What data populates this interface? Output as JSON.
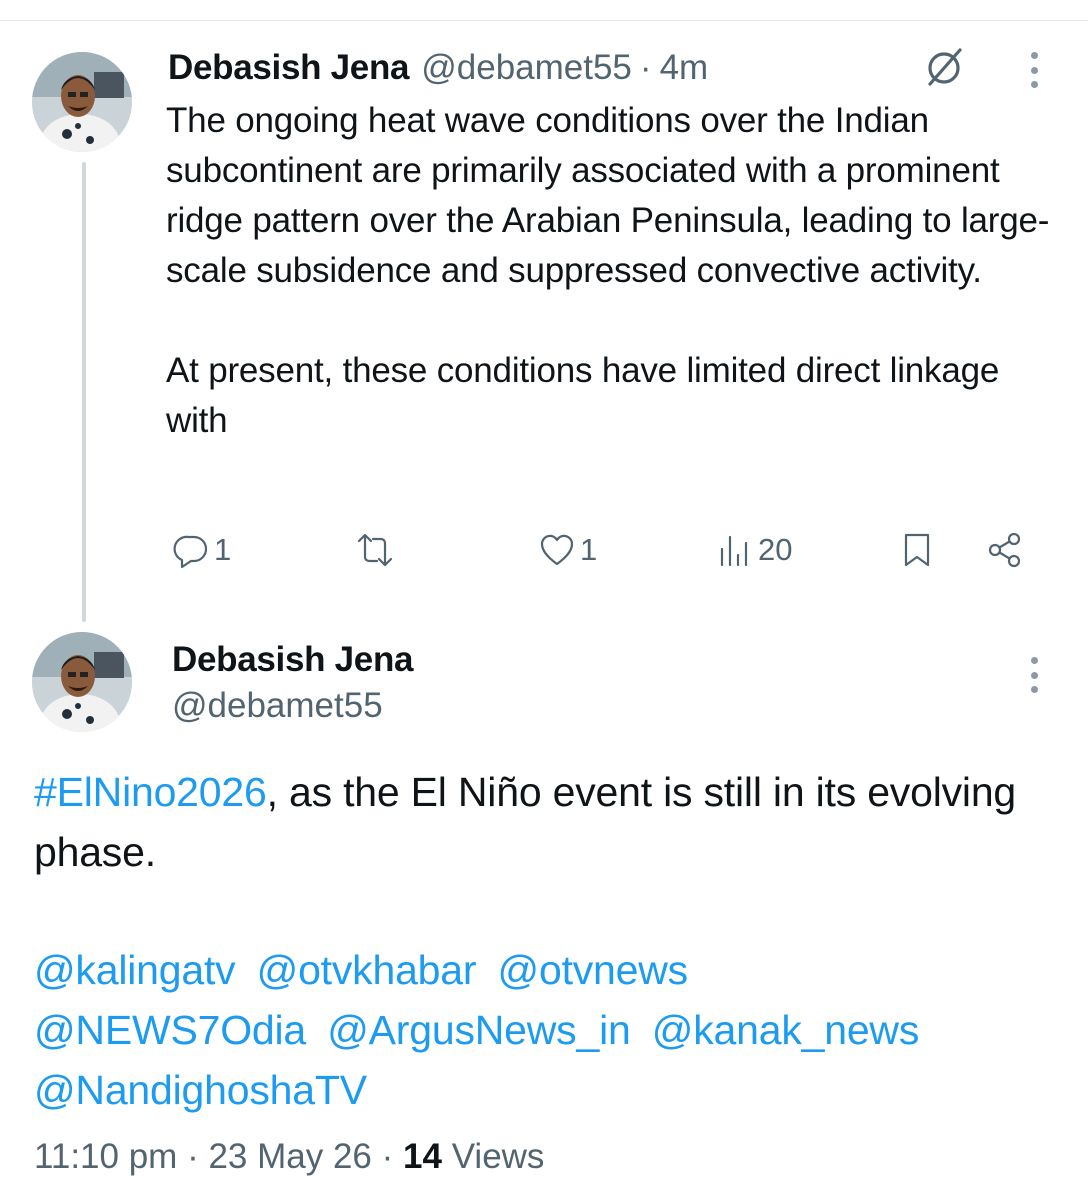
{
  "colors": {
    "link": "#1d9bf0",
    "secondary_text": "#536471",
    "primary_text": "#0f1419",
    "thread_line": "#cfd9de"
  },
  "tweet1": {
    "author_name": "Debasish Jena",
    "handle": "@debamet55",
    "separator": "·",
    "time_ago": "4m",
    "body": "The ongoing heat wave conditions over the Indian subcontinent are primarily associated with a prominent ridge pattern over the Arabian Peninsula, leading to large-scale subsidence and suppressed convective activity.\n\nAt present, these conditions have limited direct linkage with",
    "stats": {
      "replies": "1",
      "likes": "1",
      "views": "20"
    },
    "icons": [
      "grok-icon",
      "more-icon",
      "reply-icon",
      "retweet-icon",
      "like-icon",
      "views-icon",
      "bookmark-icon",
      "share-icon"
    ]
  },
  "tweet2": {
    "author_name": "Debasish Jena",
    "handle": "@debamet55",
    "hashtag": "#ElNino2026",
    "body_rest": ", as the El Niño event is still in its evolving phase.",
    "mentions": [
      "@kalingatv",
      "@otvkhabar",
      "@otvnews",
      "@NEWS7Odia",
      "@ArgusNews_in",
      "@kanak_news",
      "@NandighoshaTV"
    ],
    "time": "11:10 pm",
    "separator": "·",
    "date": "23 May 26",
    "views_count": "14",
    "views_label": "Views"
  }
}
